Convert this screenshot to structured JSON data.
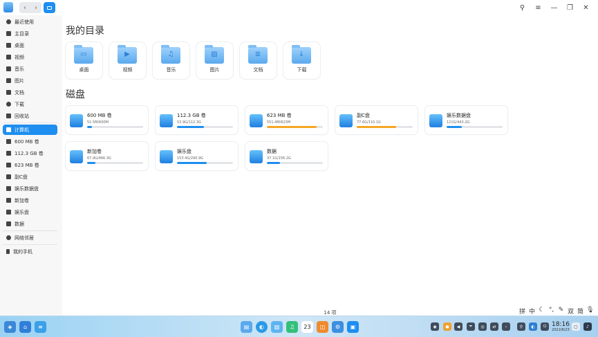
{
  "titlebar": {
    "nav_back": "‹",
    "nav_forward": "›",
    "search_icon": "⚲",
    "menu_icon": "≡",
    "minimize_icon": "—",
    "restore_icon": "❐",
    "close_icon": "✕"
  },
  "sidebar": {
    "items": [
      {
        "label": "最近使用",
        "icon": "clock-icon"
      },
      {
        "label": "主目录",
        "icon": "home-icon"
      },
      {
        "label": "桌面",
        "icon": "desktop-icon"
      },
      {
        "label": "视频",
        "icon": "video-icon"
      },
      {
        "label": "音乐",
        "icon": "music-icon"
      },
      {
        "label": "图片",
        "icon": "picture-icon"
      },
      {
        "label": "文档",
        "icon": "document-icon"
      },
      {
        "label": "下载",
        "icon": "download-icon"
      },
      {
        "label": "回收站",
        "icon": "trash-icon"
      },
      {
        "label": "计算机",
        "icon": "computer-icon",
        "active": true
      },
      {
        "label": "600 MB 卷",
        "icon": "drive-icon"
      },
      {
        "label": "112.3 GB 卷",
        "icon": "drive-icon"
      },
      {
        "label": "623 MB 卷",
        "icon": "drive-icon"
      },
      {
        "label": "副C盘",
        "icon": "drive-icon"
      },
      {
        "label": "娱乐数据盘",
        "icon": "drive-icon"
      },
      {
        "label": "新加卷",
        "icon": "drive-icon"
      },
      {
        "label": "娱乐盘",
        "icon": "drive-icon"
      },
      {
        "label": "数据",
        "icon": "drive-icon"
      },
      {
        "label": "网络邻居",
        "icon": "network-icon"
      },
      {
        "label": "我的手机",
        "icon": "phone-icon"
      }
    ]
  },
  "main": {
    "my_dirs_title": "我的目录",
    "folders": [
      {
        "label": "桌面",
        "glyph": "▭"
      },
      {
        "label": "视频",
        "glyph": "▶"
      },
      {
        "label": "音乐",
        "glyph": "♫"
      },
      {
        "label": "图片",
        "glyph": "▨"
      },
      {
        "label": "文档",
        "glyph": "≣"
      },
      {
        "label": "下载",
        "glyph": "↓"
      }
    ],
    "disks_title": "磁盘",
    "disks": [
      {
        "name": "600 MB 卷",
        "size": "51.5M/600M",
        "usage": 0.09,
        "warn": false
      },
      {
        "name": "112.3 GB 卷",
        "size": "53.9G/112.3G",
        "usage": 0.48,
        "warn": false
      },
      {
        "name": "623 MB 卷",
        "size": "551.4M/623M",
        "usage": 0.89,
        "warn": true
      },
      {
        "name": "副C盘",
        "size": "77.6G/110.1G",
        "usage": 0.7,
        "warn": true
      },
      {
        "name": "娱乐数据盘",
        "size": "121G/443.2G",
        "usage": 0.27,
        "warn": false
      },
      {
        "name": "新加卷",
        "size": "67.9G/466.3G",
        "usage": 0.15,
        "warn": false
      },
      {
        "name": "娱乐盘",
        "size": "153.4G/290.9G",
        "usage": 0.53,
        "warn": false
      },
      {
        "name": "数据",
        "size": "37.1G/156.2G",
        "usage": 0.24,
        "warn": false
      }
    ],
    "status": "14 项"
  },
  "ime": [
    "拼",
    "中",
    "☾",
    "°,",
    "✎",
    "双",
    "简",
    "🎙"
  ],
  "dock": {
    "calendar_day": "23",
    "clock_time": "18:16",
    "clock_date": "2022/6/23",
    "colors": {
      "accent": "#1e8ef0",
      "warn": "#f5a623"
    }
  }
}
